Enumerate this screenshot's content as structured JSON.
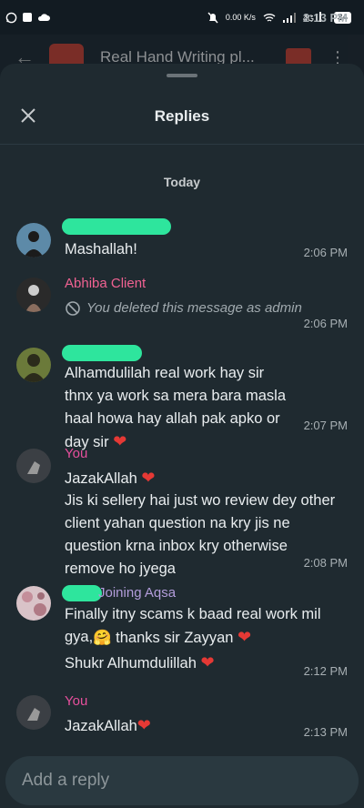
{
  "status_bar": {
    "time": "2:13 PM",
    "speed": "0.00 K/s",
    "battery": "34"
  },
  "background_chat": {
    "title": "Real Hand Writing pl..."
  },
  "sheet": {
    "title": "Replies",
    "date_label": "Today"
  },
  "messages": [
    {
      "sender": "",
      "text": "Mashallah!",
      "time": "2:06 PM"
    },
    {
      "sender": "Abhiba Client",
      "text": "You deleted this message as admin",
      "time": "2:06 PM"
    },
    {
      "sender": "",
      "text": "Alhamdulilah real work hay sir thnx ya work sa mera bara masla haal howa hay allah pak apko or day sir",
      "time": "2:07 PM"
    },
    {
      "sender": "You",
      "line1": "JazakAllah",
      "text": "Jis ki sellery hai just wo review dey other client yahan question na kry jis ne question krna inbox kry otherwise remove ho jyega",
      "time": "2:08 PM"
    },
    {
      "sender": "Joining Aqsa",
      "line1": "Finally itny scams k baad real work mil gya,",
      "line2": "thanks sir Zayyan",
      "line3": "Shukr Alhumdulillah",
      "time": "2:12 PM"
    },
    {
      "sender": "You",
      "text": "JazakAllah",
      "time": "2:13 PM"
    }
  ],
  "reply": {
    "placeholder": "Add a reply"
  },
  "colors": {
    "sender_you": "#e64f9c",
    "sender_abhiba": "#f06292",
    "sender_aqsa": "#b39ddb",
    "redaction": "#2ee59d"
  }
}
